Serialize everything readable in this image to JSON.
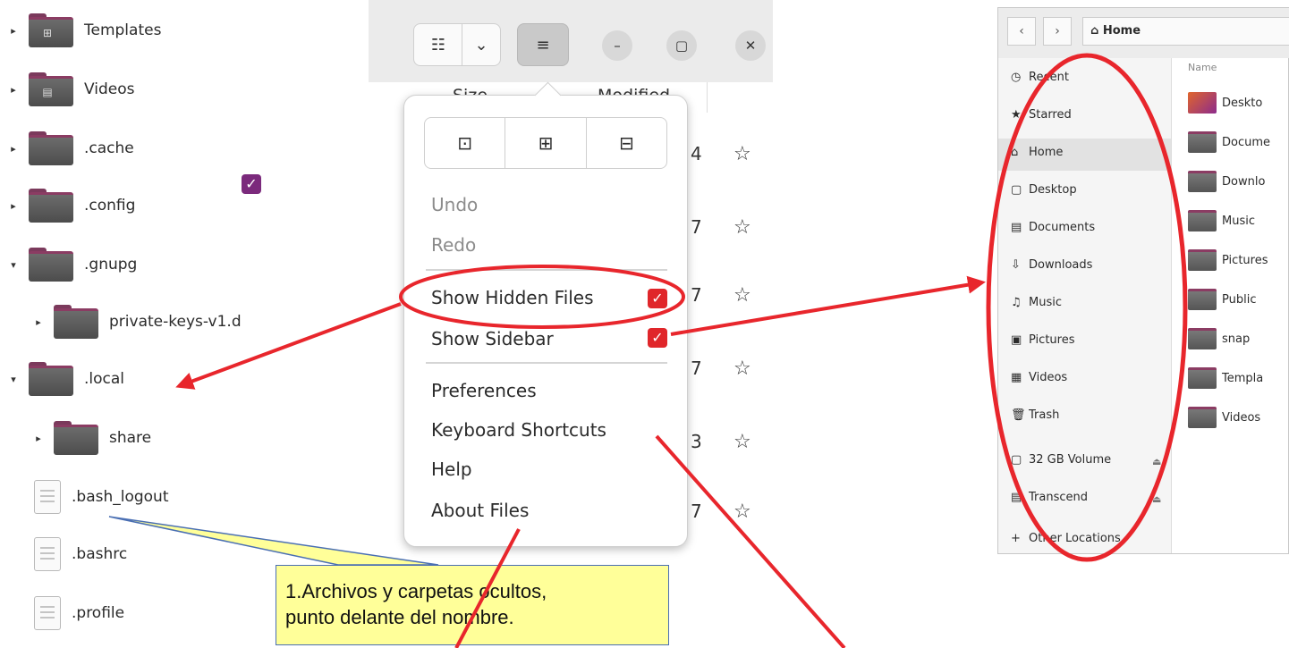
{
  "tree": {
    "items": [
      {
        "label": "Templates",
        "glyph": "⊞",
        "expander": "▸"
      },
      {
        "label": "Videos",
        "glyph": "▤",
        "expander": "▸"
      },
      {
        "label": ".cache",
        "glyph": "",
        "expander": "▸"
      },
      {
        "label": ".config",
        "glyph": "",
        "expander": "▸"
      },
      {
        "label": ".gnupg",
        "glyph": "",
        "expander": "▾"
      },
      {
        "label": "private-keys-v1.d",
        "glyph": "",
        "expander": "▸"
      },
      {
        "label": ".local",
        "glyph": "",
        "expander": "▾"
      },
      {
        "label": "share",
        "glyph": "",
        "expander": "▸"
      },
      {
        "label": ".bash_logout",
        "glyph": "",
        "expander": ""
      },
      {
        "label": ".bashrc",
        "glyph": "",
        "expander": ""
      },
      {
        "label": ".profile",
        "glyph": "",
        "expander": ""
      }
    ],
    "checkbox_mark": "✓"
  },
  "callout": {
    "line1": "1.Archivos y carpetas ocultos,",
    "line2": "punto delante del nombre."
  },
  "middle": {
    "header": {
      "grid_icon": "☷",
      "dropdown_icon": "⌄",
      "menu_icon": "≡",
      "minimize_icon": "–",
      "maximize_icon": "▢",
      "close_icon": "✕"
    },
    "columns": {
      "size": "Size",
      "modified": "Modified"
    },
    "row_digits": [
      "4",
      "7",
      "7",
      "7",
      "3",
      "7"
    ],
    "star": "☆",
    "menu": {
      "icons": [
        "⊡",
        "⊞",
        "⊟"
      ],
      "undo": "Undo",
      "redo": "Redo",
      "show_hidden": "Show Hidden Files",
      "show_sidebar": "Show Sidebar",
      "preferences": "Preferences",
      "keyboard_shortcuts": "Keyboard Shortcuts",
      "help": "Help",
      "about": "About Files",
      "check": "✓"
    }
  },
  "right": {
    "back": "‹",
    "forward": "›",
    "path": "⌂ Home",
    "sidebar": [
      {
        "icon": "◷",
        "label": "Recent"
      },
      {
        "icon": "★",
        "label": "Starred"
      },
      {
        "icon": "⌂",
        "label": "Home"
      },
      {
        "icon": "▢",
        "label": "Desktop"
      },
      {
        "icon": "▤",
        "label": "Documents"
      },
      {
        "icon": "⇩",
        "label": "Downloads"
      },
      {
        "icon": "♫",
        "label": "Music"
      },
      {
        "icon": "▣",
        "label": "Pictures"
      },
      {
        "icon": "▦",
        "label": "Videos"
      },
      {
        "icon": "🗑",
        "label": "Trash"
      },
      {
        "icon": "▢",
        "label": "32 GB Volume"
      },
      {
        "icon": "▤",
        "label": "Transcend"
      },
      {
        "icon": "+",
        "label": "Other Locations"
      }
    ],
    "eject": "⏏",
    "name_col": "Name",
    "files": [
      "Deskto",
      "Docume",
      "Downlo",
      "Music",
      "Pictures",
      "Public",
      "snap",
      "Templa",
      "Videos"
    ]
  },
  "colors": {
    "annotation_red": "#e8262c",
    "callout_yellow": "#ffff99",
    "folder_accent": "#8b3c63"
  }
}
